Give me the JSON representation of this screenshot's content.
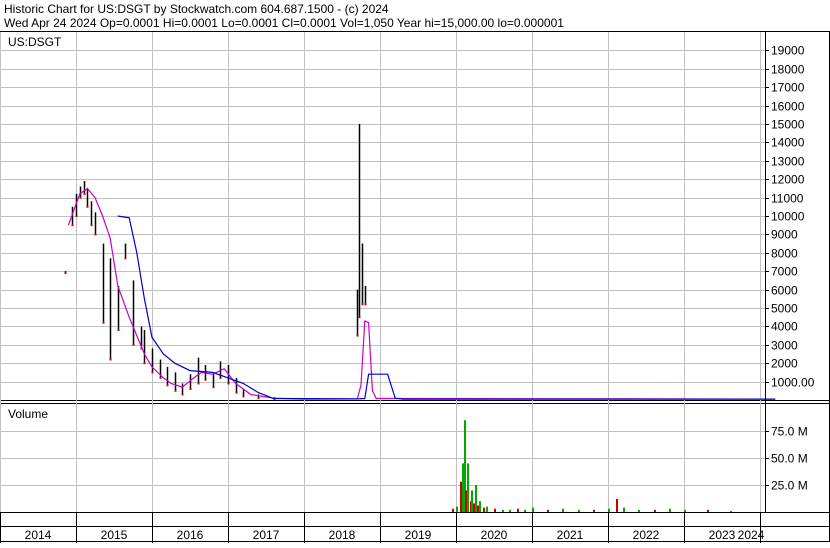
{
  "header": {
    "line1": "Historic Chart for US:DSGT by Stockwatch.com 604.687.1500 - (c) 2024",
    "line2": "Wed Apr 24 2024   Op=0.0001   Hi=0.0001   Lo=0.0001   Cl=0.0001   Vol=1,050   Year hi=15,000.00   lo=0.000001"
  },
  "colors": {
    "price_bar": "#000000",
    "price_down": "#cc0000",
    "ma_short": "#cc00cc",
    "ma_long": "#0000cc",
    "volume_up": "#00aa00",
    "volume_down": "#cc0000",
    "grid": "#c0c0c0"
  },
  "chart_data": [
    {
      "type": "bar",
      "panel": "price",
      "label": "US:DSGT",
      "ylim": [
        0,
        20000
      ],
      "y_ticks": [
        19000,
        18000,
        17000,
        16000,
        15000,
        14000,
        13000,
        12000,
        11000,
        10000,
        9000,
        8000,
        7000,
        6000,
        5000,
        4000,
        3000,
        2000,
        1000
      ],
      "y_tick_labels": [
        "19000",
        "18000",
        "17000",
        "16000",
        "15000",
        "14000",
        "13000",
        "12000",
        "11000",
        "10000",
        "9000",
        "8000",
        "7000",
        "6000",
        "5000",
        "4000",
        "3000",
        "2000",
        "1000.00"
      ],
      "x_labels": [
        "2014",
        "2015",
        "2016",
        "2017",
        "2018",
        "2019",
        "2020",
        "2021",
        "2022",
        "2023",
        "2024"
      ],
      "grid": true,
      "series": [
        {
          "kind": "hilo",
          "points": [
            [
              2014.85,
              7000,
              6900
            ],
            [
              2014.95,
              10500,
              9500
            ],
            [
              2015.0,
              11200,
              10000
            ],
            [
              2015.05,
              11600,
              11000
            ],
            [
              2015.1,
              11900,
              11200
            ],
            [
              2015.15,
              11500,
              10500
            ],
            [
              2015.2,
              10800,
              9500
            ],
            [
              2015.25,
              10200,
              9000
            ],
            [
              2015.35,
              8500,
              4200
            ],
            [
              2015.45,
              7700,
              2200
            ],
            [
              2015.55,
              6200,
              3800
            ],
            [
              2015.65,
              8500,
              7700
            ],
            [
              2015.75,
              6500,
              3000
            ],
            [
              2015.85,
              4000,
              2800
            ],
            [
              2015.9,
              3800,
              2000
            ],
            [
              2016.0,
              2800,
              1500
            ],
            [
              2016.1,
              2200,
              1200
            ],
            [
              2016.2,
              1800,
              800
            ],
            [
              2016.3,
              1500,
              500
            ],
            [
              2016.4,
              900,
              300
            ],
            [
              2016.5,
              1400,
              600
            ],
            [
              2016.6,
              2300,
              900
            ],
            [
              2016.7,
              1900,
              1100
            ],
            [
              2016.8,
              1400,
              700
            ],
            [
              2016.9,
              2100,
              1200
            ],
            [
              2017.0,
              1900,
              900
            ],
            [
              2017.1,
              1200,
              400
            ],
            [
              2017.2,
              600,
              200
            ],
            [
              2017.4,
              300,
              100
            ],
            [
              2017.6,
              150,
              50
            ],
            [
              2018.7,
              6000,
              3500
            ],
            [
              2018.73,
              15000,
              4500
            ],
            [
              2018.76,
              8500,
              5200
            ],
            [
              2018.8,
              6200,
              5200
            ]
          ]
        },
        {
          "name": "",
          "kind": "ma_short",
          "points": [
            [
              2014.9,
              9500
            ],
            [
              2015.05,
              11200
            ],
            [
              2015.15,
              11500
            ],
            [
              2015.25,
              11000
            ],
            [
              2015.35,
              10000
            ],
            [
              2015.45,
              8800
            ],
            [
              2015.55,
              6200
            ],
            [
              2015.7,
              4500
            ],
            [
              2015.8,
              3500
            ],
            [
              2015.9,
              2500
            ],
            [
              2016.0,
              1800
            ],
            [
              2016.15,
              1200
            ],
            [
              2016.25,
              900
            ],
            [
              2016.4,
              700
            ],
            [
              2016.55,
              1200
            ],
            [
              2016.65,
              1500
            ],
            [
              2016.8,
              1400
            ],
            [
              2016.95,
              1700
            ],
            [
              2017.1,
              900
            ],
            [
              2017.3,
              300
            ],
            [
              2017.6,
              100
            ],
            [
              2018.0,
              50
            ],
            [
              2018.7,
              60
            ],
            [
              2018.75,
              800
            ],
            [
              2018.8,
              4300
            ],
            [
              2018.85,
              4200
            ],
            [
              2018.9,
              500
            ],
            [
              2018.95,
              80
            ],
            [
              2024.2,
              50
            ]
          ]
        },
        {
          "name": "",
          "kind": "ma_long",
          "points": [
            [
              2015.55,
              10000
            ],
            [
              2015.7,
              9900
            ],
            [
              2015.8,
              8000
            ],
            [
              2015.9,
              5500
            ],
            [
              2016.0,
              3400
            ],
            [
              2016.15,
              2500
            ],
            [
              2016.3,
              2000
            ],
            [
              2016.5,
              1600
            ],
            [
              2016.8,
              1500
            ],
            [
              2017.0,
              1200
            ],
            [
              2017.2,
              900
            ],
            [
              2017.4,
              400
            ],
            [
              2017.6,
              80
            ],
            [
              2018.7,
              60
            ],
            [
              2018.8,
              80
            ],
            [
              2018.85,
              1400
            ],
            [
              2019.1,
              1400
            ],
            [
              2019.2,
              100
            ],
            [
              2019.3,
              50
            ],
            [
              2024.2,
              50
            ]
          ]
        }
      ]
    },
    {
      "type": "bar",
      "panel": "volume",
      "label": "Volume",
      "ylim": [
        0,
        100
      ],
      "units": "M",
      "y_ticks": [
        75,
        50,
        25
      ],
      "y_tick_labels": [
        "75.0 M",
        "50.0 M",
        "25.0 M"
      ],
      "series": [
        {
          "name": "",
          "kind": "volume",
          "x": [
            2019.95,
            2020.0,
            2020.05,
            2020.08,
            2020.1,
            2020.12,
            2020.15,
            2020.18,
            2020.2,
            2020.22,
            2020.25,
            2020.28,
            2020.3,
            2020.35,
            2020.4,
            2020.5,
            2020.6,
            2020.7,
            2020.8,
            2020.9,
            2021.0,
            2021.2,
            2021.4,
            2021.6,
            2021.8,
            2022.0,
            2022.1,
            2022.2,
            2022.4,
            2022.6,
            2022.8,
            2023.0,
            2023.3,
            2023.6
          ],
          "values": [
            3,
            5,
            28,
            45,
            85,
            20,
            45,
            10,
            20,
            8,
            25,
            6,
            10,
            4,
            5,
            3,
            2,
            2,
            3,
            2,
            4,
            2,
            3,
            2,
            2,
            3,
            12,
            4,
            2,
            2,
            3,
            2,
            2,
            1
          ],
          "down": [
            true,
            false,
            true,
            false,
            false,
            true,
            false,
            true,
            false,
            true,
            false,
            true,
            false,
            true,
            false,
            true,
            false,
            false,
            true,
            false,
            false,
            true,
            false,
            false,
            true,
            false,
            true,
            false,
            false,
            true,
            false,
            false,
            true,
            false
          ]
        }
      ]
    }
  ]
}
